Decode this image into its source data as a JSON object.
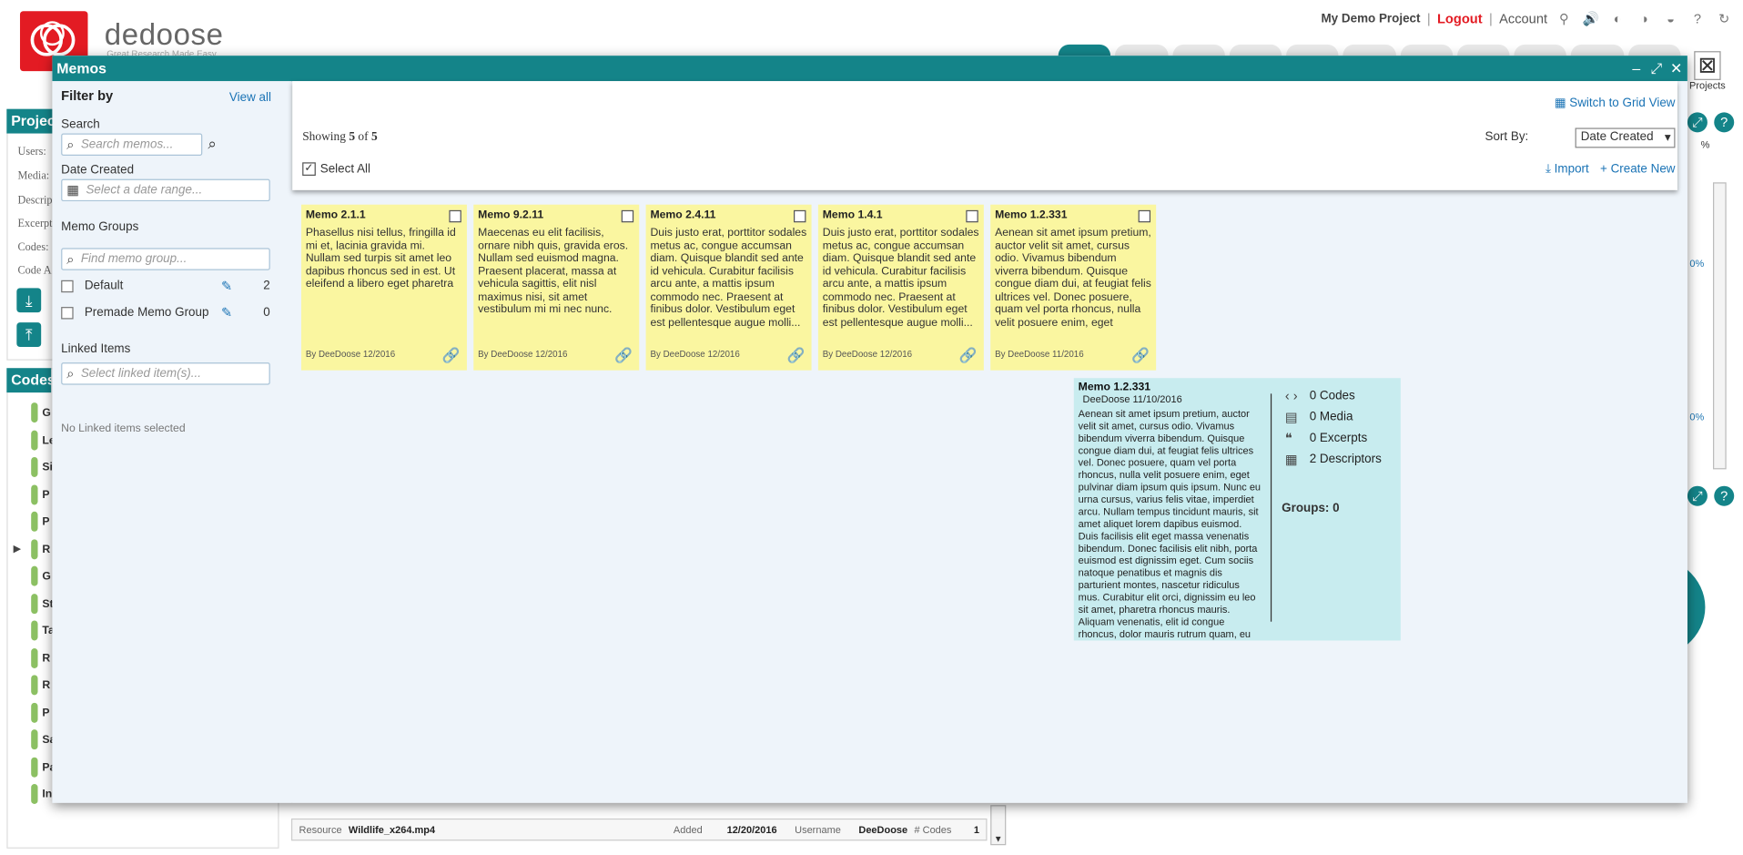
{
  "app": {
    "brand": "dedoose",
    "brand_sub": "Great Research Made Easy",
    "project_name": "My Demo Project",
    "logout": "Logout",
    "account": "Account",
    "projects_label": "Projects"
  },
  "background": {
    "project_panel_title": "Project",
    "labels": [
      "Users:",
      "Media:",
      "Descrip",
      "Excerpt",
      "Codes:",
      "Code A"
    ],
    "codes_panel_title": "Codes",
    "code_letters": [
      "G",
      "Le",
      "Si",
      "P",
      "P",
      "R",
      "G",
      "St",
      "Ta",
      "R",
      "R",
      "P",
      "Sa",
      "Pa",
      "In"
    ],
    "percent_labels": [
      "0%",
      "0%",
      "%"
    ],
    "bottom_row": {
      "resource_label": "Resource",
      "resource": "Wildlife_x264.mp4",
      "added_label": "Added",
      "added": "12/20/2016",
      "username_label": "Username",
      "username": "DeeDoose",
      "codes_label": "# Codes",
      "codes": "1"
    }
  },
  "modal": {
    "title": "Memos",
    "filter": {
      "heading": "Filter by",
      "view_all": "View all",
      "search_label": "Search",
      "search_placeholder": "Search memos...",
      "date_label": "Date Created",
      "date_placeholder": "Select a date range...",
      "groups_label": "Memo Groups",
      "group_placeholder": "Find memo group...",
      "groups": [
        {
          "name": "Default",
          "count": "2"
        },
        {
          "name": "Premade Memo Group",
          "count": "0"
        }
      ],
      "linked_label": "Linked Items",
      "linked_placeholder": "Select linked item(s)...",
      "no_linked": "No Linked items selected"
    },
    "toolbar": {
      "showing_prefix": "Showing ",
      "showing_count": "5",
      "showing_mid": " of ",
      "showing_total": "5",
      "select_all": "Select All",
      "grid_view": "Switch to Grid View",
      "sort_label": "Sort By:",
      "sort_value": "Date Created",
      "import": "Import",
      "create_new": "Create New"
    },
    "memos": [
      {
        "title": "Memo 2.1.1",
        "body": "Phasellus nisi tellus, fringilla id mi et, lacinia gravida mi. Nullam sed turpis sit amet leo dapibus rhoncus sed in est. Ut eleifend a libero eget pharetra",
        "footer": "By DeeDoose 12/2016"
      },
      {
        "title": "Memo 9.2.11",
        "body": "Maecenas eu elit facilisis, ornare nibh quis, gravida eros. Nullam sed euismod magna. Praesent placerat, massa at vehicula sagittis, elit nisl maximus nisi, sit amet vestibulum mi mi nec nunc.",
        "footer": "By DeeDoose 12/2016"
      },
      {
        "title": "Memo 2.4.11",
        "body": "Duis justo erat, porttitor sodales metus ac, congue accumsan diam. Quisque blandit sed ante id vehicula. Curabitur facilisis arcu ante, a mattis ipsum commodo nec. Praesent at finibus dolor. Vestibulum eget est pellentesque augue molli...",
        "footer": "By DeeDoose 12/2016"
      },
      {
        "title": "Memo 1.4.1",
        "body": "Duis justo erat, porttitor sodales metus ac, congue accumsan diam. Quisque blandit sed ante id vehicula. Curabitur facilisis arcu ante, a mattis ipsum commodo nec. Praesent at finibus dolor. Vestibulum eget est pellentesque augue molli...",
        "footer": "By DeeDoose 12/2016"
      },
      {
        "title": "Memo 1.2.331",
        "body": "Aenean sit amet ipsum pretium, auctor velit sit amet, cursus odio. Vivamus bibendum viverra bibendum. Quisque congue diam dui, at feugiat felis ultrices vel. Donec posuere, quam vel porta rhoncus, nulla velit posuere enim, eget pulvinar di...",
        "footer": "By DeeDoose 11/2016"
      }
    ],
    "detail": {
      "title": "Memo 1.2.331",
      "subtitle": "DeeDoose 11/10/2016",
      "body": "Aenean sit amet ipsum pretium, auctor velit sit amet, cursus odio. Vivamus bibendum viverra bibendum. Quisque congue diam dui, at feugiat felis ultrices vel. Donec posuere, quam vel porta rhoncus, nulla velit posuere enim, eget pulvinar diam ipsum quis ipsum. Nunc eu urna cursus, varius felis vitae, imperdiet arcu. Nullam tempus tincidunt mauris, sit amet aliquet lorem dapibus euismod. Duis facilisis elit eget massa venenatis bibendum. Donec facilisis elit nibh, porta euismod est dignissim eget. Cum sociis natoque penatibus et magnis dis parturient montes, nascetur ridiculus mus. Curabitur elit orci, dignissim eu leo sit amet, pharetra rhoncus mauris. Aliquam venenatis, elit id congue rhoncus, dolor mauris rutrum quam, eu",
      "codes": "0 Codes",
      "media": "0 Media",
      "excerpts": "0 Excerpts",
      "descriptors": "2 Descriptors",
      "groups": "Groups: 0"
    }
  },
  "colors": {
    "teal": "#148489",
    "memo_yellow": "#faf6a0",
    "detail_cyan": "#c8ecef",
    "link_blue": "#1a73b5",
    "logout_red": "#e31b23"
  }
}
